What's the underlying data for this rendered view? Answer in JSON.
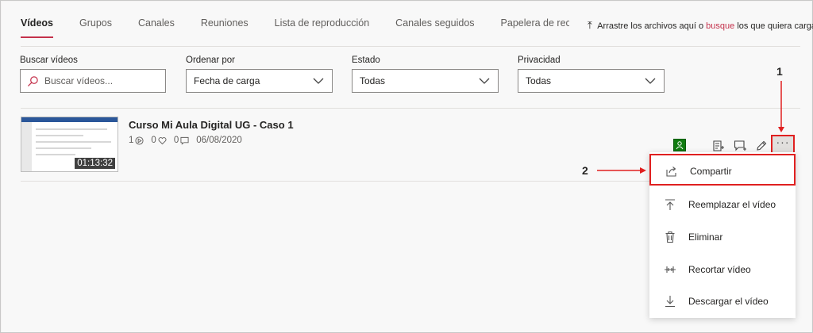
{
  "tabs": [
    {
      "label": "Vídeos"
    },
    {
      "label": "Grupos"
    },
    {
      "label": "Canales"
    },
    {
      "label": "Reuniones"
    },
    {
      "label": "Lista de reproducción"
    },
    {
      "label": "Canales seguidos"
    },
    {
      "label": "Papelera de reciclaje"
    }
  ],
  "upload_hint": {
    "prefix": "Arrastre los archivos aquí o",
    "link": "busque",
    "suffix": "los que quiera cargar."
  },
  "filters": {
    "search": {
      "label": "Buscar vídeos",
      "placeholder": "Buscar vídeos..."
    },
    "sort": {
      "label": "Ordenar por",
      "value": "Fecha de carga"
    },
    "state": {
      "label": "Estado",
      "value": "Todas"
    },
    "privacy": {
      "label": "Privacidad",
      "value": "Todas"
    }
  },
  "video": {
    "title": "Curso Mi Aula Digital UG - Caso 1",
    "views": "1",
    "likes": "0",
    "comments": "0",
    "date": "06/08/2020",
    "duration": "01:13:32"
  },
  "more_label": "···",
  "menu": [
    {
      "label": "Compartir",
      "icon": "share-icon"
    },
    {
      "label": "Reemplazar el vídeo",
      "icon": "upload-icon"
    },
    {
      "label": "Eliminar",
      "icon": "trash-icon"
    },
    {
      "label": "Recortar vídeo",
      "icon": "trim-icon"
    },
    {
      "label": "Descargar el vídeo",
      "icon": "download-icon"
    }
  ],
  "annotations": {
    "one": "1",
    "two": "2"
  },
  "colors": {
    "accent": "#c4314b",
    "highlight": "#e02020",
    "badge": "#107c10"
  }
}
